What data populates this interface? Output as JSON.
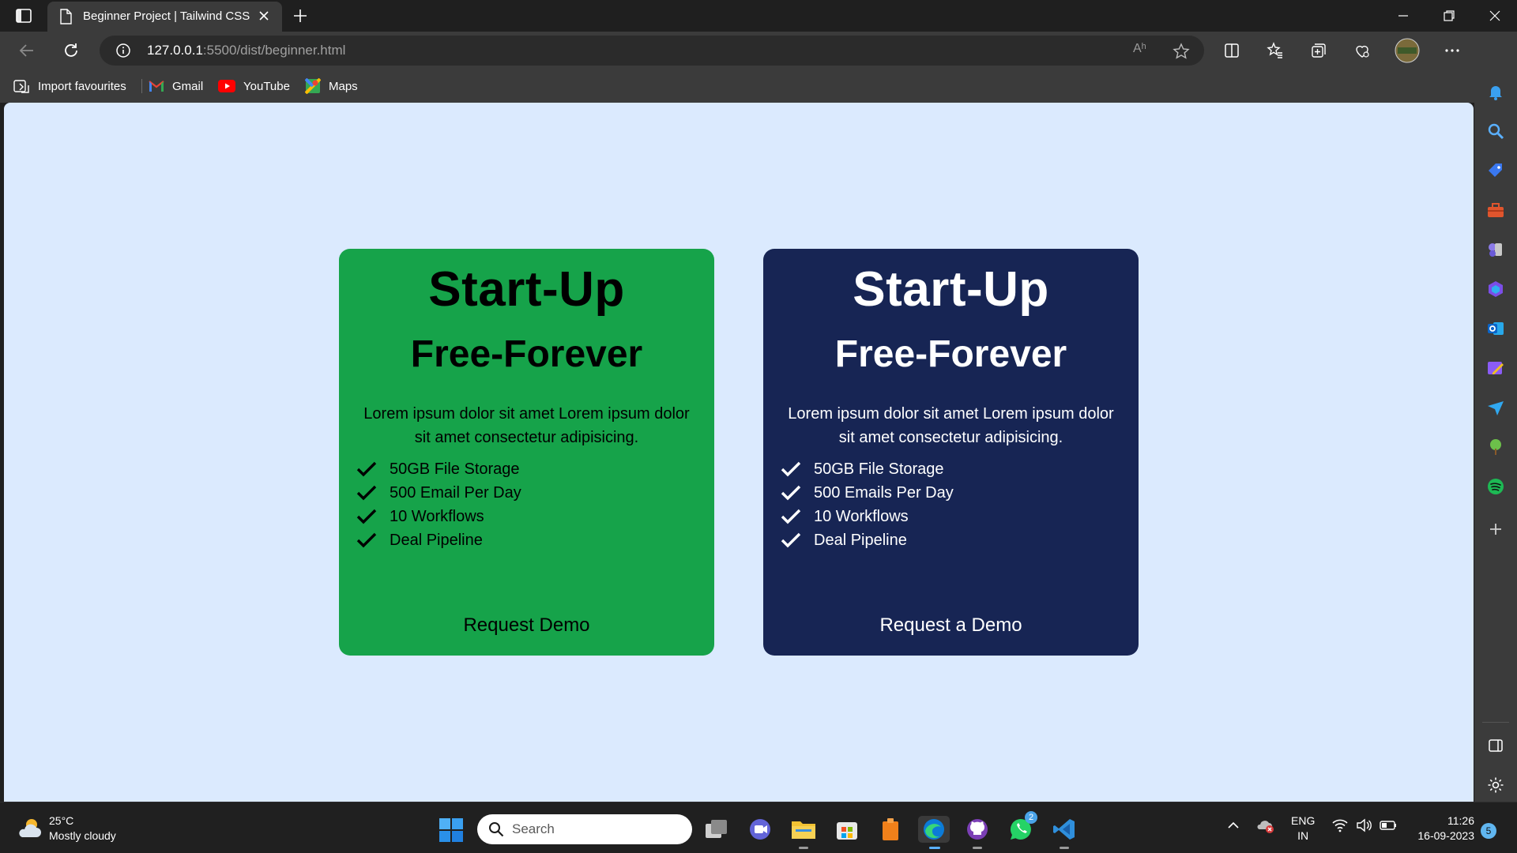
{
  "browser": {
    "tab_title": "Beginner Project | Tailwind CSS",
    "url_host": "127.0.0.1",
    "url_path": ":5500/dist/beginner.html",
    "read_aloud_label": "Aʰ"
  },
  "bookmarks": [
    {
      "label": "Import favourites",
      "icon": "import-icon"
    },
    {
      "label": "Gmail",
      "icon": "gmail-icon"
    },
    {
      "label": "YouTube",
      "icon": "youtube-icon"
    },
    {
      "label": "Maps",
      "icon": "maps-icon"
    }
  ],
  "cards": [
    {
      "title": "Start-Up",
      "subtitle": "Free-Forever",
      "description": "Lorem ipsum dolor sit amet Lorem ipsum dolor sit amet consectetur adipisicing.",
      "features": [
        "50GB File Storage",
        "500 Email Per Day",
        "10 Workflows",
        "Deal Pipeline"
      ],
      "cta": "Request Demo",
      "bg_color": "#16a34a",
      "text_color": "#000000"
    },
    {
      "title": "Start-Up",
      "subtitle": "Free-Forever",
      "description": "Lorem ipsum dolor sit amet Lorem ipsum dolor sit amet consectetur adipisicing.",
      "features": [
        "50GB File Storage",
        "500 Emails Per Day",
        "10 Workflows",
        "Deal Pipeline"
      ],
      "cta": "Request a Demo",
      "bg_color": "#172554",
      "text_color": "#ffffff"
    }
  ],
  "page_bg": "#dbeafe",
  "taskbar": {
    "weather_temp": "25°C",
    "weather_desc": "Mostly cloudy",
    "search_placeholder": "Search",
    "whatsapp_badge": "2",
    "lang_top": "ENG",
    "lang_bottom": "IN",
    "time": "11:26",
    "date": "16-09-2023",
    "notification_count": "5"
  }
}
